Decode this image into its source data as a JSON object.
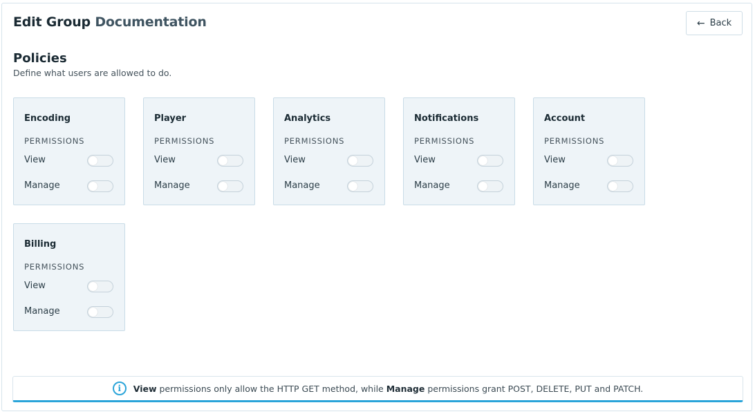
{
  "header": {
    "title_prefix": "Edit Group",
    "group_name": "Documentation",
    "back_label": "Back"
  },
  "policies": {
    "title": "Policies",
    "description": "Define what users are allowed to do."
  },
  "permissions_label": "PERMISSIONS",
  "view_label": "View",
  "manage_label": "Manage",
  "cards": [
    {
      "title": "Encoding",
      "view": false,
      "manage": false
    },
    {
      "title": "Player",
      "view": false,
      "manage": false
    },
    {
      "title": "Analytics",
      "view": false,
      "manage": false
    },
    {
      "title": "Notifications",
      "view": false,
      "manage": false
    },
    {
      "title": "Account",
      "view": false,
      "manage": false
    },
    {
      "title": "Billing",
      "view": false,
      "manage": false
    }
  ],
  "info": {
    "icon": "info-icon",
    "view_word": "View",
    "part1": " permissions only allow the HTTP GET method, while ",
    "manage_word": "Manage",
    "part2": " permissions grant POST, DELETE, PUT and PATCH."
  },
  "colors": {
    "accent": "#2aa4d9",
    "card_bg": "#eef4f8"
  }
}
